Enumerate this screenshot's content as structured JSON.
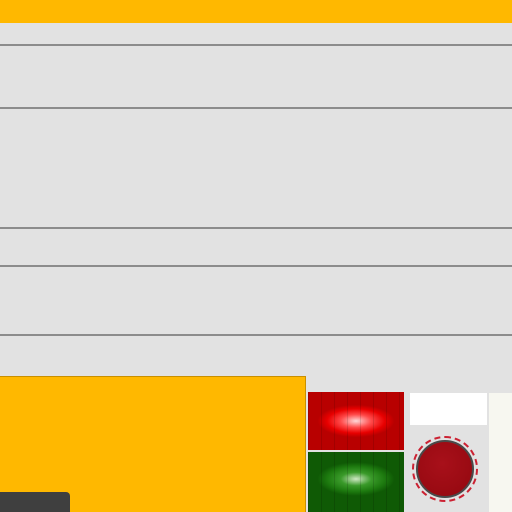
{
  "colors": {
    "accent": "#ffb800",
    "background": "#e2e2e2",
    "divider": "#8c8c8c",
    "red_button": "#e80000",
    "green_button": "#1d7a0f",
    "stop_button": "#990a12",
    "dark_tab": "#3f3f3f"
  },
  "list": {
    "rows": [
      "",
      "",
      "",
      "",
      ""
    ]
  },
  "controls": {
    "red_button_label": "",
    "green_button_label": "",
    "stop_button_icon": "stop-icon",
    "display_text": ""
  },
  "bottom_panel": {
    "tab_label": ""
  }
}
